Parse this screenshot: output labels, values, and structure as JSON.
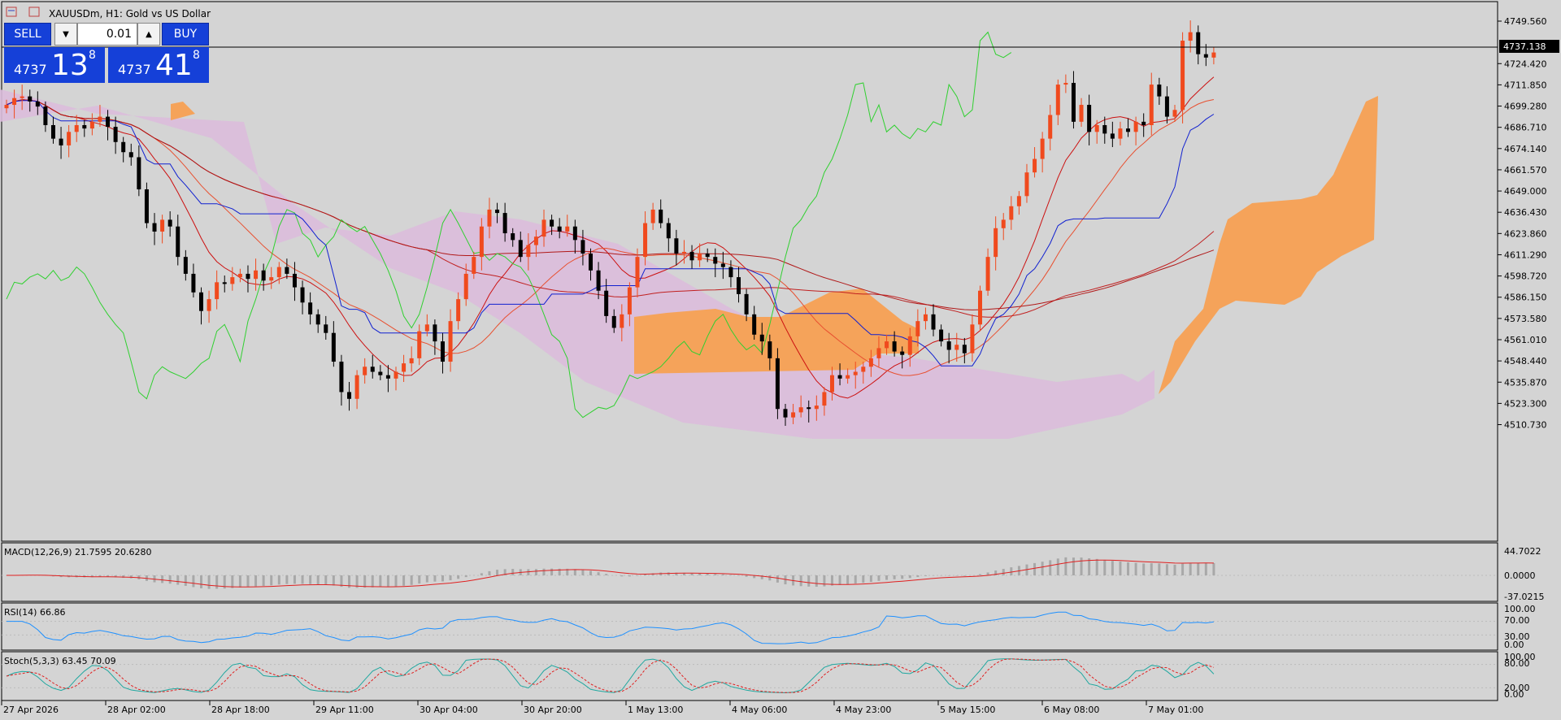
{
  "title": "XAUUSDm, H1:  Gold vs US Dollar",
  "trade": {
    "sell_label": "SELL",
    "buy_label": "BUY",
    "lot": "0.01",
    "bid_small": "4737",
    "bid_big": "13",
    "bid_sup": "8",
    "ask_small": "4737",
    "ask_big": "41",
    "ask_sup": "8",
    "down_arrow": "▼",
    "up_arrow": "▲"
  },
  "colors": {
    "bull": "#f04a1e",
    "bear": "#000000",
    "bg": "#d4d4d4",
    "cloud_up": "#f5a35a",
    "cloud_down": "#dcbcdc"
  },
  "price_axis": [
    "4749.560",
    "4737.138",
    "4724.420",
    "4711.850",
    "4699.280",
    "4686.710",
    "4674.140",
    "4661.570",
    "4649.000",
    "4636.430",
    "4623.860",
    "4611.290",
    "4598.720",
    "4586.150",
    "4573.580",
    "4561.010",
    "4548.440",
    "4535.870",
    "4523.300",
    "4510.730"
  ],
  "current_price": "4737.138",
  "time_axis": [
    "27 Apr 2026",
    "28 Apr 02:00",
    "28 Apr 18:00",
    "29 Apr 11:00",
    "30 Apr 04:00",
    "30 Apr 20:00",
    "1 May 13:00",
    "4 May 06:00",
    "4 May 23:00",
    "5 May 15:00",
    "6 May 08:00",
    "7 May 01:00"
  ],
  "macd": {
    "label": "MACD(12,26,9) 21.7595 20.6280",
    "ticks": [
      "44.7022",
      "0.0000",
      "-37.0215"
    ]
  },
  "rsi": {
    "label": "RSI(14) 66.86",
    "ticks": [
      "100.00",
      "70.00",
      "30.00",
      "0.00"
    ]
  },
  "stoch": {
    "label": "Stoch(5,3,3) 63.45 70.09",
    "ticks": [
      "100.00",
      "80.00",
      "20.00",
      "0.00"
    ]
  },
  "chart_data": {
    "type": "candlestick",
    "symbol": "XAUUSDm",
    "timeframe": "H1",
    "ylim": [
      4500,
      4755
    ],
    "close_series": [
      4700,
      4704,
      4705,
      4702,
      4699,
      4688,
      4680,
      4676,
      4684,
      4688,
      4686,
      4690,
      4693,
      4687,
      4678,
      4672,
      4669,
      4650,
      4630,
      4625,
      4632,
      4628,
      4610,
      4600,
      4589,
      4578,
      4585,
      4595,
      4594,
      4598,
      4600,
      4597,
      4602,
      4596,
      4598,
      4604,
      4600,
      4592,
      4583,
      4576,
      4570,
      4565,
      4548,
      4530,
      4526,
      4540,
      4545,
      4542,
      4540,
      4538,
      4542,
      4547,
      4550,
      4566,
      4570,
      4560,
      4548,
      4572,
      4585,
      4600,
      4610,
      4628,
      4638,
      4636,
      4624,
      4620,
      4610,
      4617,
      4622,
      4632,
      4628,
      4625,
      4628,
      4620,
      4612,
      4602,
      4590,
      4575,
      4568,
      4576,
      4592,
      4610,
      4630,
      4638,
      4630,
      4621,
      4612,
      4613,
      4608,
      4612,
      4610,
      4606,
      4604,
      4598,
      4588,
      4576,
      4564,
      4560,
      4550,
      4520,
      4515,
      4518,
      4521,
      4520,
      4522,
      4530,
      4540,
      4538,
      4540,
      4542,
      4545,
      4550,
      4556,
      4560,
      4554,
      4552,
      4563,
      4572,
      4576,
      4567,
      4560,
      4555,
      4558,
      4553,
      4570,
      4590,
      4610,
      4627,
      4632,
      4640,
      4646,
      4660,
      4668,
      4680,
      4694,
      4712,
      4713,
      4690,
      4700,
      4684,
      4688,
      4683,
      4680,
      4686,
      4684,
      4690,
      4688,
      4712,
      4705,
      4693,
      4697,
      4738,
      4743,
      4730,
      4728,
      4731
    ],
    "moving_averages": [
      {
        "name": "red",
        "period": 10,
        "color": "#cc1010"
      },
      {
        "name": "light-red",
        "period": 20,
        "color": "#e85030"
      },
      {
        "name": "dark-red",
        "period": 55,
        "color": "#c02020"
      },
      {
        "name": "dark-red-2",
        "period": 100,
        "color": "#b01818"
      }
    ]
  }
}
